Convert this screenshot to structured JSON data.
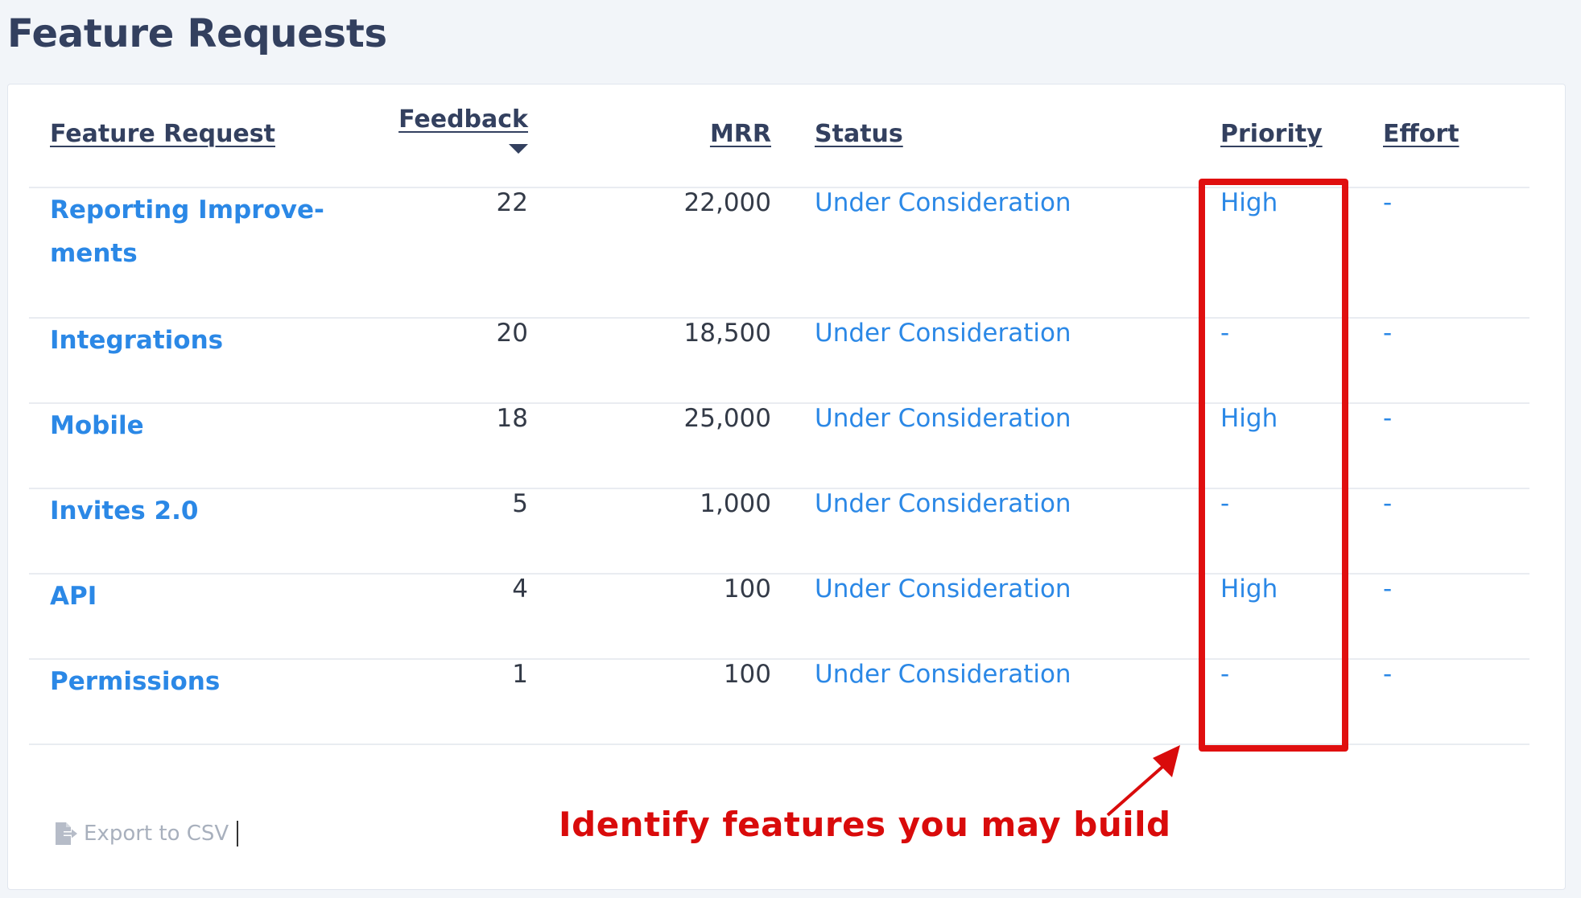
{
  "page": {
    "title": "Feature Requests"
  },
  "table": {
    "headers": {
      "feature": "Feature Request",
      "feedback": "Feedback",
      "mrr": "MRR",
      "status": "Status",
      "priority": "Priority",
      "effort": "Effort"
    },
    "sort": {
      "column": "Feedback",
      "direction": "descending",
      "icon": "caret-down-icon"
    },
    "rows": [
      {
        "name": "Reporting Improve-ments",
        "name_line1": "Reporting Improve-",
        "name_line2": "ments",
        "feedback": "22",
        "mrr": "22,000",
        "status": "Under Consideration",
        "priority": "High",
        "effort": "-"
      },
      {
        "name": "Integrations",
        "feedback": "20",
        "mrr": "18,500",
        "status": "Under Consideration",
        "priority": "-",
        "effort": "-"
      },
      {
        "name": "Mobile",
        "feedback": "18",
        "mrr": "25,000",
        "status": "Under Consideration",
        "priority": "High",
        "effort": "-"
      },
      {
        "name": "Invites 2.0",
        "feedback": "5",
        "mrr": "1,000",
        "status": "Under Consideration",
        "priority": "-",
        "effort": "-"
      },
      {
        "name": "API",
        "feedback": "4",
        "mrr": "100",
        "status": "Under Consideration",
        "priority": "High",
        "effort": "-"
      },
      {
        "name": "Permissions",
        "feedback": "1",
        "mrr": "100",
        "status": "Under Consideration",
        "priority": "-",
        "effort": "-"
      }
    ]
  },
  "footer": {
    "export_label": "Export to CSV",
    "export_icon": "file-export-icon"
  },
  "annotation": {
    "text": "Identify features you may build",
    "color": "#d90b0b"
  },
  "colors": {
    "link": "#2b88e6",
    "heading": "#33405f",
    "highlight": "#e00f0f"
  }
}
